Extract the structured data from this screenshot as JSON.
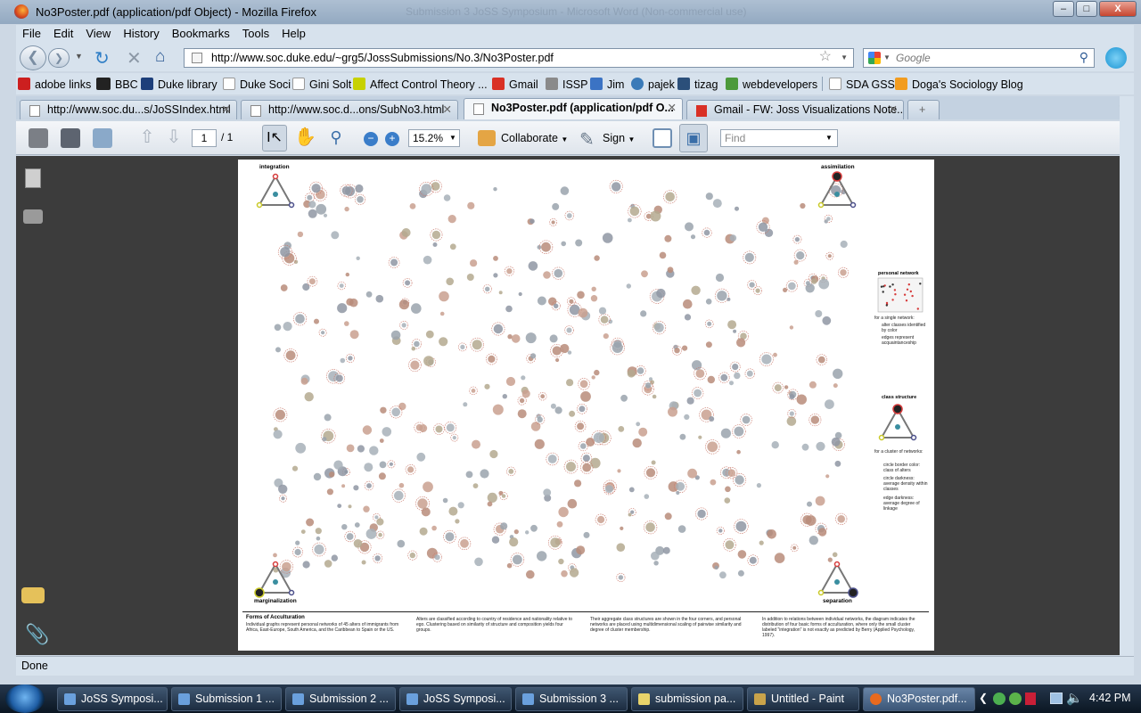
{
  "window": {
    "title": "No3Poster.pdf (application/pdf Object) - Mozilla Firefox",
    "background_title": "Submission 3 JoSS Symposium - Microsoft Word (Non-commercial use)"
  },
  "menu": [
    "File",
    "Edit",
    "View",
    "History",
    "Bookmarks",
    "Tools",
    "Help"
  ],
  "nav": {
    "url": "http://www.soc.duke.edu/~grg5/JossSubmissions/No.3/No3Poster.pdf",
    "search_placeholder": "Google"
  },
  "bookmarks": [
    {
      "label": "adobe links",
      "color": "#cc1f1f"
    },
    {
      "label": "BBC",
      "color": "#222222"
    },
    {
      "label": "Duke library",
      "color": "#1d3f7a"
    },
    {
      "label": "Duke Soci",
      "color": "#ffffff"
    },
    {
      "label": "Gini Solt",
      "color": "#ffffff"
    },
    {
      "label": "Affect Control Theory ...",
      "color": "#c7d100"
    },
    {
      "label": "Gmail",
      "color": "#d93025"
    },
    {
      "label": "ISSP",
      "color": "#8a8a8a"
    },
    {
      "label": "Jim",
      "color": "#3b73c4"
    },
    {
      "label": "pajek",
      "color": "#3a7ab8"
    },
    {
      "label": "tizag",
      "color": "#2b4f7a"
    },
    {
      "label": "webdevelopers",
      "color": "#4c9a3b"
    },
    {
      "label": "SDA GSS",
      "color": "#ffffff"
    },
    {
      "label": "Doga's Sociology Blog",
      "color": "#f29c1f"
    }
  ],
  "tabs": [
    {
      "label": "http://www.soc.du...s/JoSSIndex.html",
      "active": false
    },
    {
      "label": "http://www.soc.d...ons/SubNo3.html",
      "active": false
    },
    {
      "label": "No3Poster.pdf (application/pdf O...",
      "active": true
    },
    {
      "label": "Gmail - FW: Joss Visualizations Note...",
      "active": false
    }
  ],
  "pdf_toolbar": {
    "page_current": "1",
    "page_total": "/ 1",
    "zoom": "15.2%",
    "collaborate": "Collaborate",
    "sign": "Sign",
    "find_placeholder": "Find"
  },
  "poster": {
    "corners": {
      "tl": "integration",
      "tr": "assimilation",
      "bl": "marginalization",
      "br": "separation"
    },
    "legend": {
      "personal_network": "personal network",
      "single_network": "for a single network:",
      "single_items": [
        "alter classes identified by color",
        "edges represent acquaintanceship"
      ],
      "class_structure": "class structure",
      "cluster_networks": "for a cluster of networks:",
      "cluster_items": [
        "circle border color: class of alters",
        "circle darkness: average density within classes",
        "edge darkness: average degree of linkage"
      ]
    },
    "footer": {
      "title": "Forms of Acculturation",
      "col1": "Individual graphs represent personal networks of 45 alters of immigrants from Africa, East-Europe, South America, and the Caribbean to Spain or the US.",
      "col2": "Alters are classified according to country of residence and nationality relative to ego. Clustering based on similarity of structure and composition yields four groups.",
      "col3": "Their aggregate class structures are shown in the four corners, and personal networks are placed using multidimensional scaling of pairwise similarity and degree of cluster membership.",
      "col4": "In addition to relations between individual networks, the diagram indicates the distribution of four basic forms of acculturation, where only the small cluster labeled \"integration\" is not exactly as predicted by Berry (Applied Psychology, 1997)."
    }
  },
  "status": "Done",
  "taskbar": {
    "items": [
      {
        "label": "JoSS Symposi...",
        "color": "#3b7de0",
        "active": false
      },
      {
        "label": "Submission 1 ...",
        "color": "#3b7de0",
        "active": false
      },
      {
        "label": "Submission 2 ...",
        "color": "#3b7de0",
        "active": false
      },
      {
        "label": "JoSS Symposi...",
        "color": "#3b7de0",
        "active": false
      },
      {
        "label": "Submission 3 ...",
        "color": "#3b7de0",
        "active": false
      },
      {
        "label": "submission pa...",
        "color": "#e8d36a",
        "active": false
      },
      {
        "label": "Untitled - Paint",
        "color": "#c9a34a",
        "active": false
      },
      {
        "label": "No3Poster.pdf...",
        "color": "#e86a1f",
        "active": true
      }
    ],
    "clock": "4:42 PM"
  }
}
